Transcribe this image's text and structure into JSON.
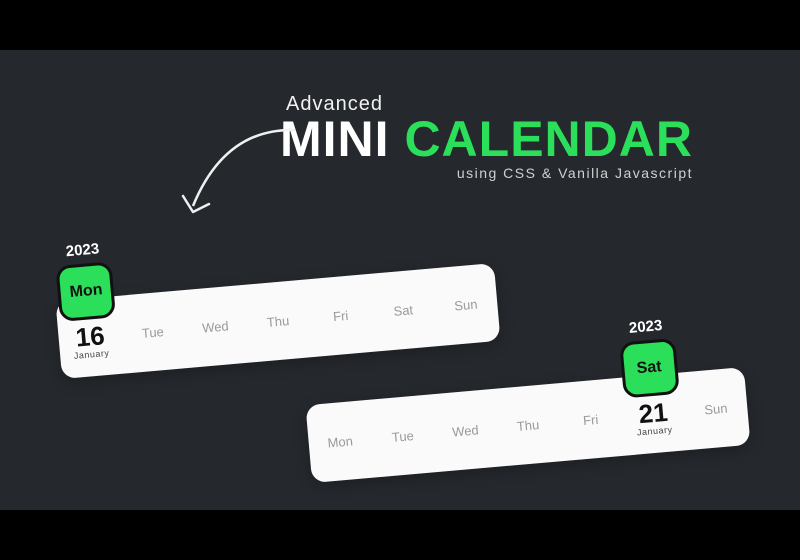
{
  "title": {
    "line1": "Advanced",
    "word1": "MINI",
    "word2": "CALENDAR",
    "subtitle": "using CSS & Vanilla Javascript"
  },
  "widgets": [
    {
      "year": "2023",
      "selectedDay": "Mon",
      "selectedDate": "16",
      "selectedMonth": "January",
      "days": [
        "Tue",
        "Wed",
        "Thu",
        "Fri",
        "Sat",
        "Sun"
      ]
    },
    {
      "year": "2023",
      "selectedDay": "Sat",
      "selectedDate": "21",
      "selectedMonth": "January",
      "daysBefore": [
        "Mon",
        "Tue",
        "Wed",
        "Thu",
        "Fri"
      ],
      "daysAfter": [
        "Sun"
      ]
    }
  ],
  "colors": {
    "accent": "#2bdf5a",
    "bg": "#25282d"
  }
}
